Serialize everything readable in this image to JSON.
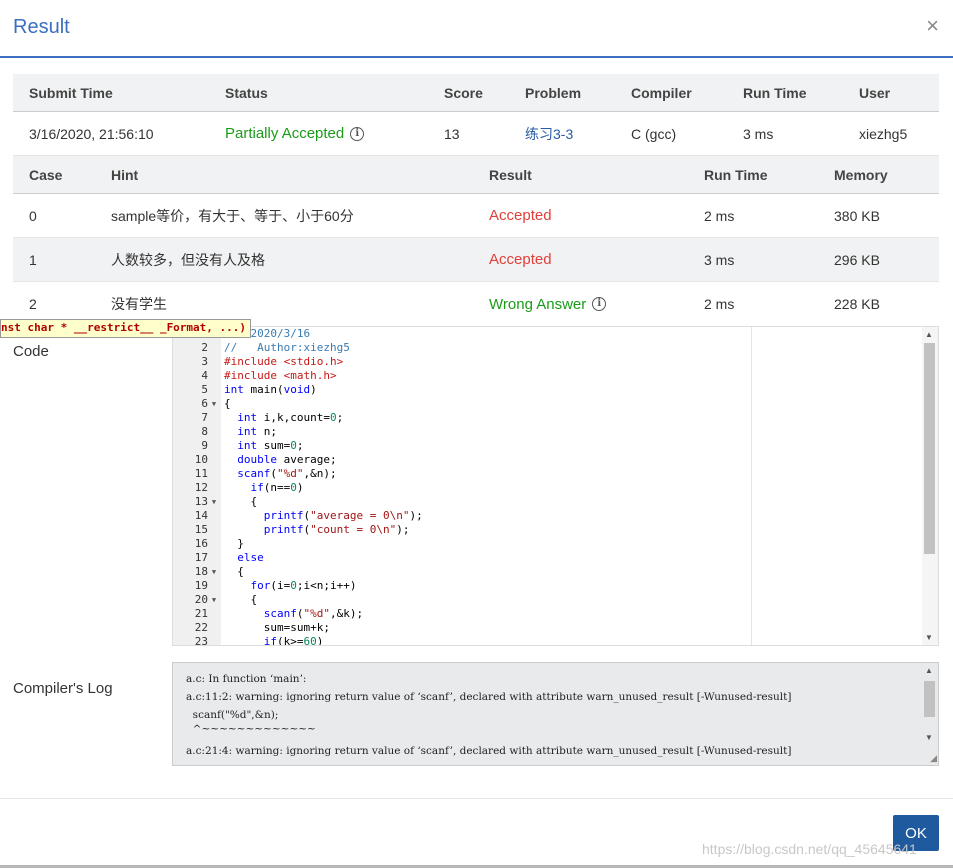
{
  "modal": {
    "title": "Result",
    "close_label": "×",
    "ok_label": "OK"
  },
  "submission": {
    "headers": [
      "Submit Time",
      "Status",
      "Score",
      "Problem",
      "Compiler",
      "Run Time",
      "User"
    ],
    "row": {
      "submit_time": "3/16/2020, 21:56:10",
      "status": "Partially Accepted",
      "score": "13",
      "problem": "练习3-3",
      "compiler": "C (gcc)",
      "run_time": "3 ms",
      "user": "xiezhg5"
    }
  },
  "cases": {
    "headers": [
      "Case",
      "Hint",
      "Result",
      "Run Time",
      "Memory"
    ],
    "rows": [
      {
        "case": "0",
        "hint": "sample等价，有大于、等于、小于60分",
        "result": "Accepted",
        "run_time": "2 ms",
        "memory": "380 KB"
      },
      {
        "case": "1",
        "hint": "人数较多，但没有人及格",
        "result": "Accepted",
        "run_time": "3 ms",
        "memory": "296 KB"
      },
      {
        "case": "2",
        "hint": "没有学生",
        "result": "Wrong Answer",
        "run_time": "2 ms",
        "memory": "228 KB"
      }
    ]
  },
  "code": {
    "label": "Code",
    "tooltip": "nst char * __restrict__ _Format, ...)",
    "first_line_visible": "ate:2020/3/16",
    "line_numbers": [
      "2",
      "3",
      "4",
      "5",
      "6",
      "7",
      "8",
      "9",
      "10",
      "11",
      "12",
      "13",
      "14",
      "15",
      "16",
      "17",
      "18",
      "19",
      "20",
      "21",
      "22",
      "23"
    ]
  },
  "compiler_log": {
    "label": "Compiler's Log",
    "lines": [
      "a.c: In function ‘main’:",
      "a.c:11:2: warning: ignoring return value of ‘scanf’, declared with attribute warn_unused_result [-Wunused-result]",
      "  scanf(\"%d\",&n);",
      "  ^~~~~~~~~~~~~~",
      "a.c:21:4: warning: ignoring return value of ‘scanf’, declared with attribute warn_unused_result [-Wunused-result]"
    ]
  },
  "watermark": "https://blog.csdn.net/qq_45645641",
  "colors": {
    "accent": "#3b6fbf",
    "accepted": "#e0403b",
    "partial": "#1a9c1a",
    "button": "#1f5a9e"
  }
}
